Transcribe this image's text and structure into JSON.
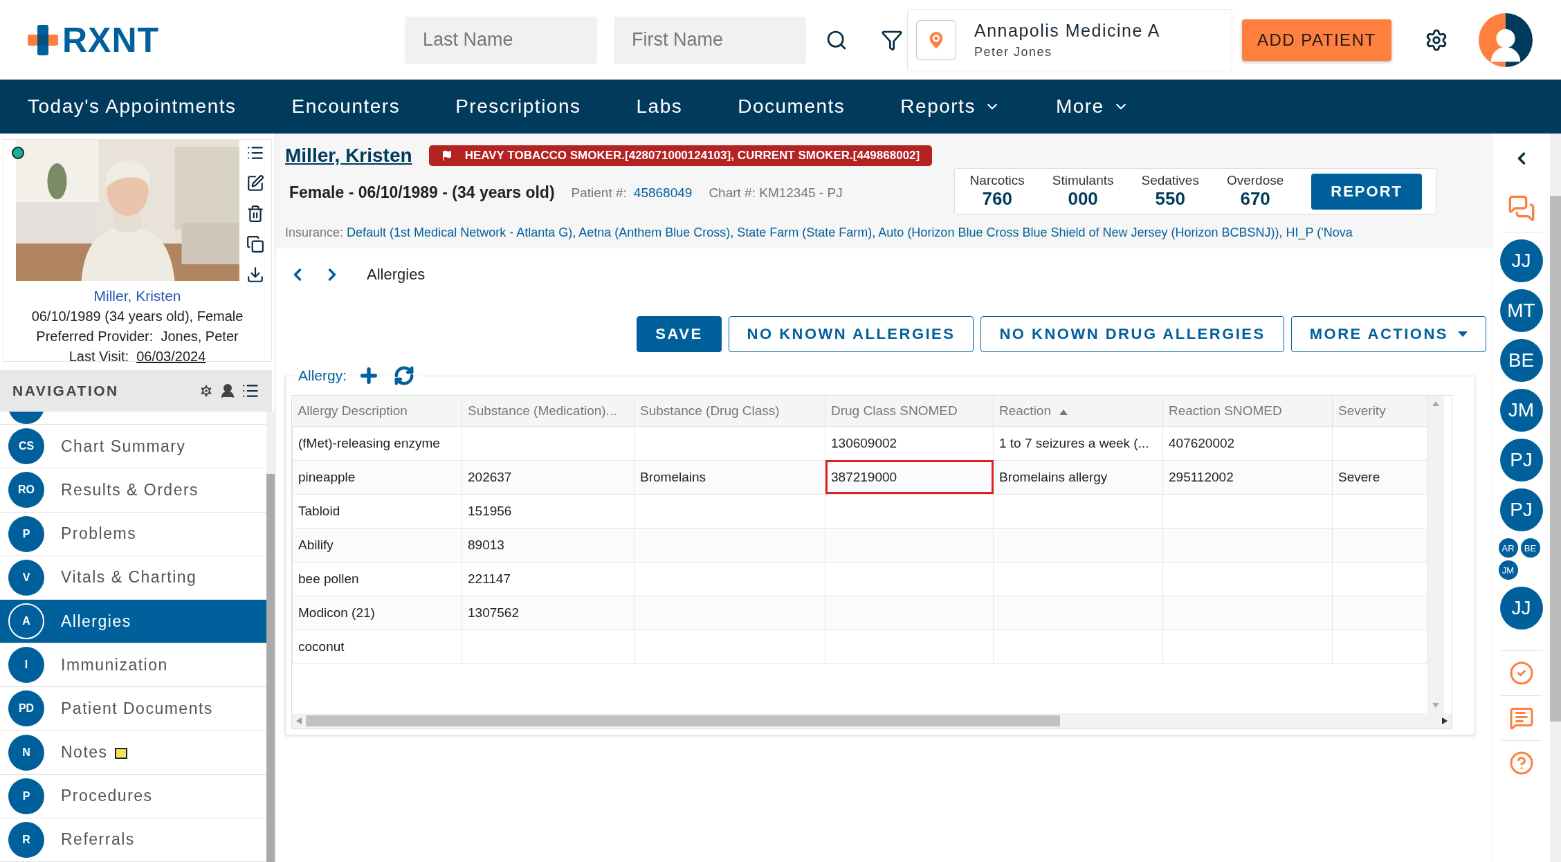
{
  "header": {
    "logo": "RXNT",
    "last_name": {
      "placeholder": "Last Name"
    },
    "first_name": {
      "placeholder": "First Name"
    },
    "location": {
      "name": "Annapolis Medicine A",
      "user": "Peter Jones"
    },
    "add_button": "ADD PATIENT"
  },
  "nav": [
    {
      "label": "Today's Appointments",
      "has_menu": false
    },
    {
      "label": "Encounters",
      "has_menu": false
    },
    {
      "label": "Prescriptions",
      "has_menu": false
    },
    {
      "label": "Labs",
      "has_menu": false
    },
    {
      "label": "Documents",
      "has_menu": false
    },
    {
      "label": "Reports",
      "has_menu": true
    },
    {
      "label": "More",
      "has_menu": true
    }
  ],
  "patient_card": {
    "name": "Miller, Kristen",
    "dob": "06/10/1989 (34 years old), Female",
    "provider_label": "Preferred Provider:",
    "provider": "Jones, Peter",
    "last_visit_label": "Last Visit:",
    "last_visit": "06/03/2024"
  },
  "navigation": {
    "title": "NAVIGATION",
    "items": [
      {
        "badge": "CS",
        "label": "Chart Summary",
        "selected": false,
        "note": false
      },
      {
        "badge": "RO",
        "label": "Results & Orders",
        "selected": false,
        "note": false
      },
      {
        "badge": "P",
        "label": "Problems",
        "selected": false,
        "note": false
      },
      {
        "badge": "V",
        "label": "Vitals & Charting",
        "selected": false,
        "note": false
      },
      {
        "badge": "A",
        "label": "Allergies",
        "selected": true,
        "note": false
      },
      {
        "badge": "I",
        "label": "Immunization",
        "selected": false,
        "note": false
      },
      {
        "badge": "PD",
        "label": "Patient Documents",
        "selected": false,
        "note": false
      },
      {
        "badge": "N",
        "label": "Notes",
        "selected": false,
        "note": true
      },
      {
        "badge": "P",
        "label": "Procedures",
        "selected": false,
        "note": false
      },
      {
        "badge": "R",
        "label": "Referrals",
        "selected": false,
        "note": false
      }
    ]
  },
  "patient_header": {
    "name": "Miller, Kristen",
    "alert": "HEAVY TOBACCO SMOKER.[428071000124103], CURRENT SMOKER.[449868002]",
    "summary": "Female - 06/10/1989 - (34 years old)",
    "patient_label": "Patient #:",
    "patient_number": "45868049",
    "chart": "Chart #: KM12345 - PJ",
    "counts": [
      {
        "label": "Narcotics",
        "value": "760"
      },
      {
        "label": "Stimulants",
        "value": "000"
      },
      {
        "label": "Sedatives",
        "value": "550"
      },
      {
        "label": "Overdose",
        "value": "670"
      }
    ],
    "report_button": "REPORT",
    "insurance_label": "Insurance:",
    "insurance": "Default (1st Medical Network - Atlanta G), Aetna (Anthem Blue Cross), State Farm (State Farm), Auto (Horizon Blue Cross Blue Shield of New Jersey (Horizon BCBSNJ)), HI_P ('Nova"
  },
  "breadcrumb": "Allergies",
  "actions": [
    {
      "label": "SAVE",
      "kind": "primary"
    },
    {
      "label": "NO KNOWN ALLERGIES",
      "kind": "outline"
    },
    {
      "label": "NO KNOWN DRUG ALLERGIES",
      "kind": "outline"
    },
    {
      "label": "MORE ACTIONS",
      "kind": "menu"
    }
  ],
  "allergy_panel": {
    "legend": "Allergy:",
    "columns": [
      {
        "label": "Allergy Description",
        "sorted": false
      },
      {
        "label": "Substance (Medication)...",
        "sorted": false
      },
      {
        "label": "Substance (Drug Class)",
        "sorted": false
      },
      {
        "label": "Drug Class SNOMED",
        "sorted": false
      },
      {
        "label": "Reaction",
        "sorted": true
      },
      {
        "label": "Reaction SNOMED",
        "sorted": false
      },
      {
        "label": "Severity",
        "sorted": false
      }
    ],
    "rows": [
      {
        "cells": [
          {
            "text": "(fMet)-releasing enzyme",
            "selected": false
          },
          {
            "selected": false
          },
          {
            "selected": false
          },
          {
            "text": "130609002",
            "selected": false
          },
          {
            "text": "1 to 7 seizures a week (...",
            "selected": false
          },
          {
            "text": "407620002",
            "selected": false
          },
          {
            "selected": false
          }
        ]
      },
      {
        "cells": [
          {
            "text": "pineapple",
            "selected": false
          },
          {
            "text": "202637",
            "selected": false
          },
          {
            "text": "Bromelains",
            "selected": false
          },
          {
            "text": "387219000",
            "selected": true
          },
          {
            "text": "Bromelains allergy",
            "selected": false
          },
          {
            "text": "295112002",
            "selected": false
          },
          {
            "text": "Severe",
            "selected": false
          }
        ]
      },
      {
        "cells": [
          {
            "text": "Tabloid",
            "selected": false
          },
          {
            "text": "151956",
            "selected": false
          },
          {
            "selected": false
          },
          {
            "selected": false
          },
          {
            "selected": false
          },
          {
            "selected": false
          },
          {
            "selected": false
          }
        ]
      },
      {
        "cells": [
          {
            "text": "Abilify",
            "selected": false
          },
          {
            "text": "89013",
            "selected": false
          },
          {
            "selected": false
          },
          {
            "selected": false
          },
          {
            "selected": false
          },
          {
            "selected": false
          },
          {
            "selected": false
          }
        ]
      },
      {
        "cells": [
          {
            "text": "bee pollen",
            "selected": false
          },
          {
            "text": "221147",
            "selected": false
          },
          {
            "selected": false
          },
          {
            "selected": false
          },
          {
            "selected": false
          },
          {
            "selected": false
          },
          {
            "selected": false
          }
        ]
      },
      {
        "cells": [
          {
            "text": "Modicon (21)",
            "selected": false
          },
          {
            "text": "1307562",
            "selected": false
          },
          {
            "selected": false
          },
          {
            "selected": false
          },
          {
            "selected": false
          },
          {
            "selected": false
          },
          {
            "selected": false
          }
        ]
      },
      {
        "cells": [
          {
            "text": "coconut",
            "selected": false
          },
          {
            "selected": false
          },
          {
            "selected": false
          },
          {
            "selected": false
          },
          {
            "selected": false
          },
          {
            "selected": false
          },
          {
            "selected": false
          }
        ]
      }
    ]
  },
  "right_rail": {
    "avatars": [
      {
        "initials": "JJ",
        "kind": "large"
      },
      {
        "initials": "MT",
        "kind": "large"
      },
      {
        "initials": "BE",
        "kind": "large"
      },
      {
        "initials": "JM",
        "kind": "large"
      },
      {
        "initials": "PJ",
        "kind": "large"
      },
      {
        "initials": "PJ",
        "kind": "large"
      },
      {
        "initials": "AR",
        "kind": "small"
      },
      {
        "initials": "BE",
        "kind": "small"
      },
      {
        "initials": "JM",
        "kind": "small"
      },
      {
        "initials": "JJ",
        "kind": "large"
      }
    ]
  }
}
